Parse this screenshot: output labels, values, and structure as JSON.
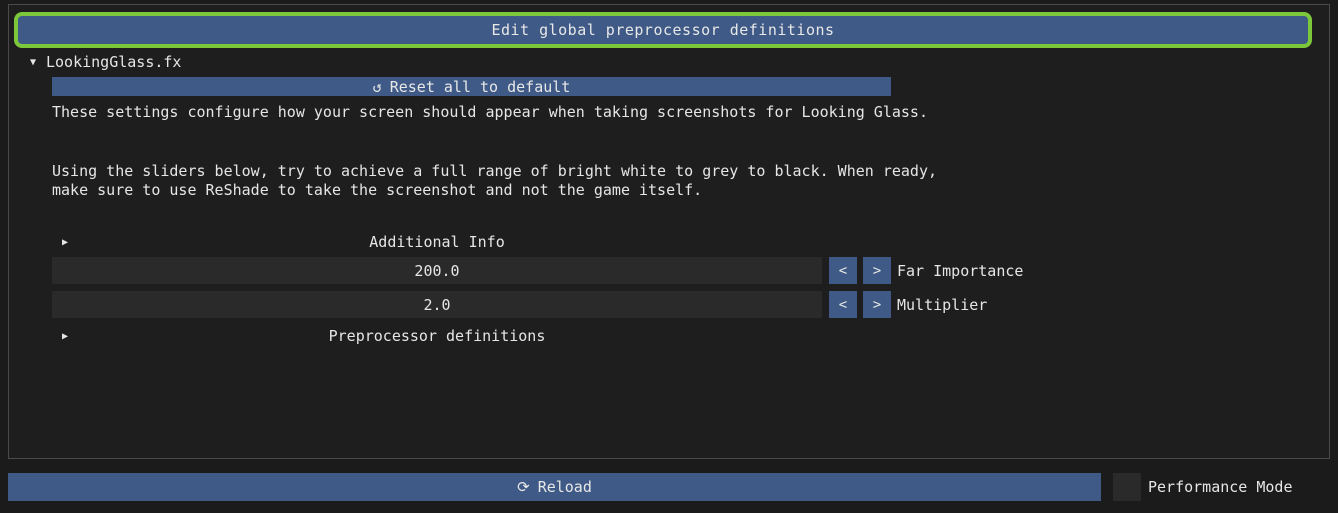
{
  "header": {
    "edit_global_label": "Edit global preprocessor definitions"
  },
  "effect": {
    "name": "LookingGlass.fx",
    "reset_label": "Reset all to default",
    "reset_icon": "undo-icon",
    "description_1": "These settings configure how your screen should appear when taking screenshots for Looking Glass.",
    "description_2": "Using the sliders below, try to achieve a full range of bright white to grey to black. When ready,",
    "description_3": "make sure to use ReShade to take the screenshot and not the game itself.",
    "additional_info_label": "Additional Info",
    "sliders": [
      {
        "value": "200.0",
        "label": "Far Importance",
        "dec": "<",
        "inc": ">"
      },
      {
        "value": "2.0",
        "label": "Multiplier",
        "dec": "<",
        "inc": ">"
      }
    ],
    "preprocessor_label": "Preprocessor definitions"
  },
  "footer": {
    "reload_label": "Reload",
    "reload_icon": "refresh-icon",
    "performance_mode_label": "Performance Mode",
    "performance_mode_checked": false
  },
  "colors": {
    "accent": "#3f5a86",
    "highlight": "#7cc83a",
    "frame_bg": "#2a2a2a"
  }
}
